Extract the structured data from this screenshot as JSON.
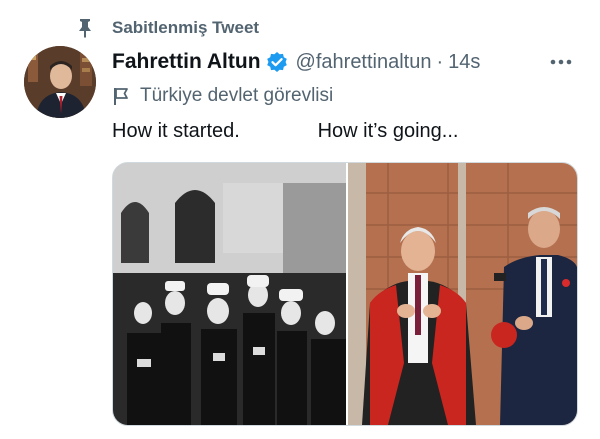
{
  "pinned": {
    "label": "Sabitlenmiş Tweet",
    "icon": "pin-icon"
  },
  "author": {
    "display_name": "Fahrettin Altun",
    "handle": "@fahrettinaltun",
    "separator": "·",
    "timestamp": "14s",
    "verified": true,
    "verified_color": "#1d9bf0"
  },
  "label": {
    "icon": "flag-icon",
    "text": "Türkiye devlet görevlisi"
  },
  "tweet": {
    "text": "How it started.              How it’s going..."
  },
  "media": {
    "count": 2,
    "left_photo": "historical-group-photo",
    "right_photo": "ceremony-photo"
  },
  "colors": {
    "secondary_text": "#536471",
    "primary_text": "#0f1419",
    "accent": "#1d9bf0"
  }
}
